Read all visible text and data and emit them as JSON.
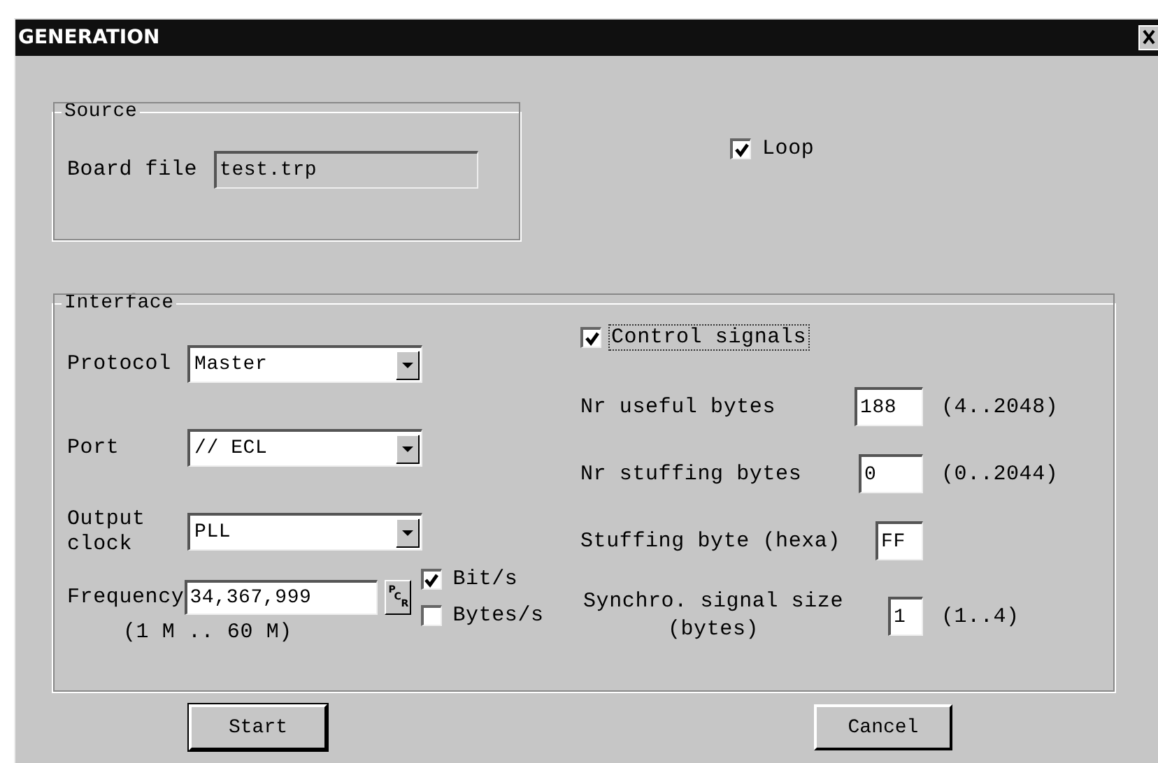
{
  "window": {
    "title": "GENERATION"
  },
  "source": {
    "title": "Source",
    "board_file": {
      "label": "Board file",
      "value": "test.trp"
    }
  },
  "loop": {
    "label": "Loop",
    "checked": true
  },
  "interface": {
    "title": "Interface",
    "combos": [
      {
        "label": "Protocol",
        "value": "Master"
      },
      {
        "label": "Port",
        "value": "// ECL"
      },
      {
        "label": "Output clock",
        "value": "PLL"
      }
    ],
    "frequency": {
      "label": "Frequency",
      "value": "34,367,999",
      "range": "(1 M .. 60 M)",
      "pcr_button": "PCR"
    },
    "units": [
      {
        "label": "Bit/s",
        "checked": true
      },
      {
        "label": "Bytes/s",
        "checked": false
      }
    ],
    "control_signals": {
      "label": "Control signals",
      "checked": true
    },
    "params": [
      {
        "label": "Nr useful bytes",
        "value": "188",
        "range": "(4..2048)"
      },
      {
        "label": "Nr stuffing bytes",
        "value": "0",
        "range": "(0..2044)"
      },
      {
        "label": "Stuffing byte (hexa)",
        "value": "FF"
      },
      {
        "label": "Synchro. signal size (bytes)",
        "value": "1",
        "range": "(1..4)"
      }
    ]
  },
  "buttons": [
    "Start",
    "Cancel"
  ]
}
